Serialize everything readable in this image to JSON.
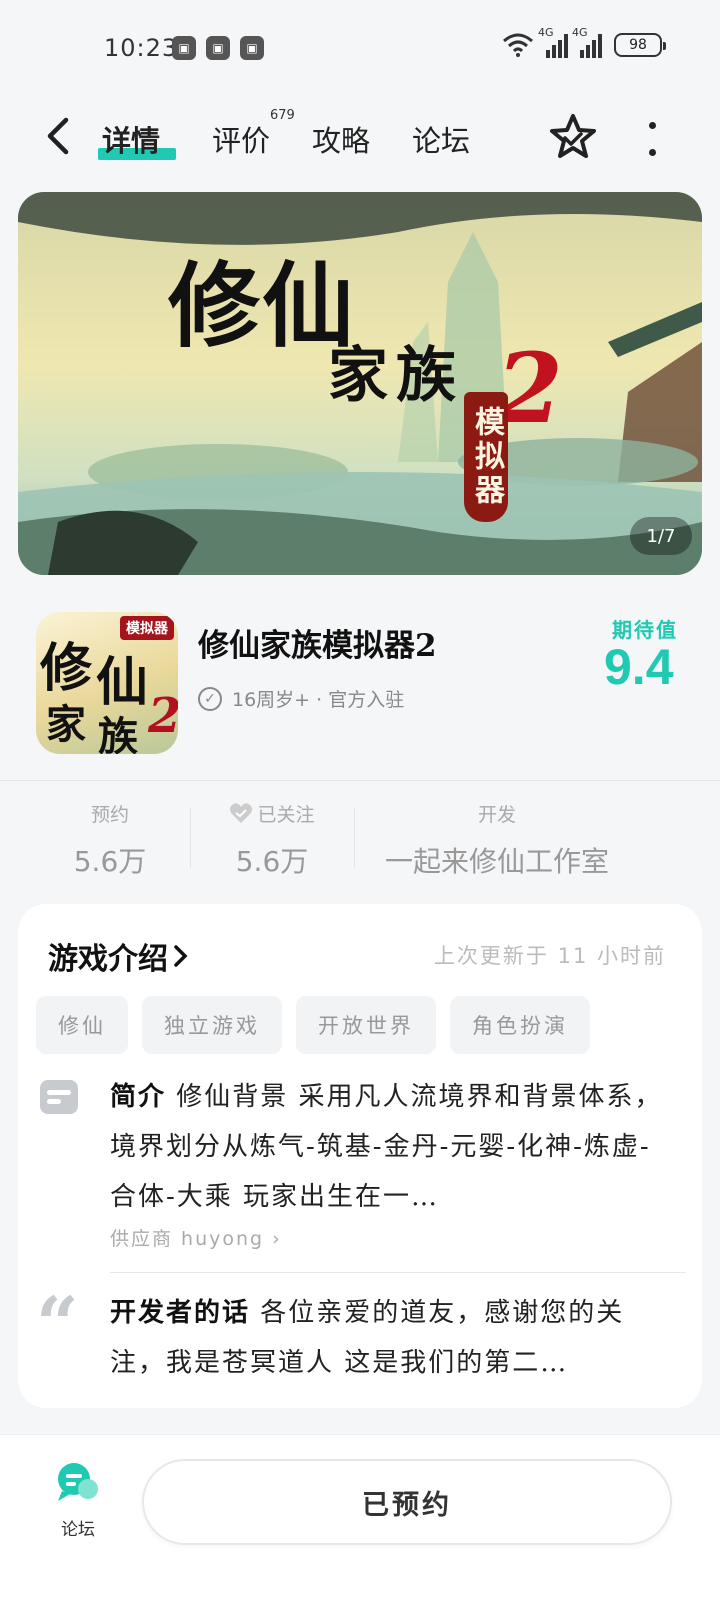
{
  "status_bar": {
    "time": "10:23",
    "network_1": "4G",
    "network_2": "4G",
    "battery": "98"
  },
  "nav": {
    "tabs": [
      {
        "label": "详情"
      },
      {
        "label": "评价"
      },
      {
        "label": "攻略"
      },
      {
        "label": "论坛"
      }
    ],
    "review_count": "679"
  },
  "banner": {
    "title_line1": "修仙",
    "title_line2": "家族",
    "number": "2",
    "subtitle": "模拟器",
    "counter": "1/7"
  },
  "app": {
    "icon_badge": "模拟器",
    "icon_chars": [
      "修",
      "仙",
      "家",
      "族",
      "2"
    ],
    "name": "修仙家族模拟器2",
    "meta": "16周岁+ · 官方入驻",
    "expect_label": "期待值",
    "expect_score": "9.4",
    "accent_color": "#20c9b1"
  },
  "stats": [
    {
      "key": "预约",
      "value": "5.6万"
    },
    {
      "key": "已关注",
      "value": "5.6万"
    },
    {
      "key": "开发",
      "value": "一起来修仙工作室"
    }
  ],
  "intro": {
    "title": "游戏介绍",
    "updated": "上次更新于 11 小时前",
    "tags": [
      "修仙",
      "独立游戏",
      "开放世界",
      "角色扮演"
    ],
    "summary_label": "简介",
    "summary_text": " 修仙背景 采用凡人流境界和背景体系，境界划分从炼气-筑基-金丹-元婴-化神-炼虚-合体-大乘 玩家出生在一…",
    "supplier": "供应商 huyong",
    "dev_label": "开发者的话",
    "dev_text": " 各位亲爱的道友，感谢您的关注，我是苍冥道人 这是我们的第二…"
  },
  "bottom_bar": {
    "forum_label": "论坛",
    "reserved_label": "已预约"
  }
}
